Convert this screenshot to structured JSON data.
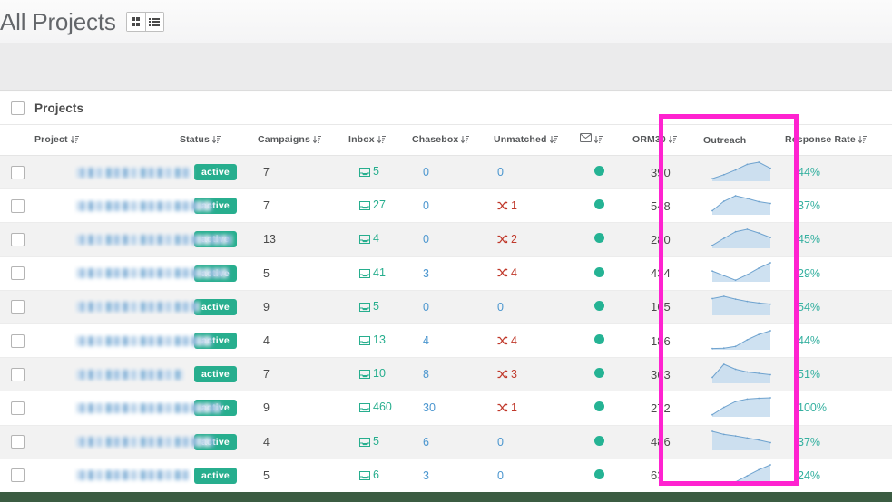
{
  "header": {
    "title": "All Projects",
    "view_toggle": [
      {
        "name": "grid-view",
        "label": "grid"
      },
      {
        "name": "list-view",
        "label": "list"
      }
    ]
  },
  "card": {
    "label": "Projects",
    "select_all_checkbox": ""
  },
  "columns": [
    {
      "key": "project",
      "label": "Project",
      "sortable": true
    },
    {
      "key": "status",
      "label": "Status",
      "sortable": true
    },
    {
      "key": "campaigns",
      "label": "Campaigns",
      "sortable": true
    },
    {
      "key": "inbox",
      "label": "Inbox",
      "sortable": true
    },
    {
      "key": "chasebox",
      "label": "Chasebox",
      "sortable": true
    },
    {
      "key": "unmatched",
      "label": "Unmatched",
      "sortable": true
    },
    {
      "key": "email",
      "label": "",
      "sortable": true,
      "icon": "envelope-icon"
    },
    {
      "key": "orm30",
      "label": "ORM30",
      "sortable": true
    },
    {
      "key": "outreach",
      "label": "Outreach",
      "sortable": false
    },
    {
      "key": "response",
      "label": "Response Rate",
      "sortable": true
    }
  ],
  "rows": [
    {
      "project_redacted_width": 128,
      "status": "active",
      "campaigns": "7",
      "inbox": "5",
      "chasebox": "0",
      "unmatched": "0",
      "unmatched_flagged": false,
      "email_status": "ok",
      "orm30": "390",
      "response": "44%",
      "sparkline": [
        12,
        30,
        52,
        78,
        88,
        60
      ]
    },
    {
      "project_redacted_width": 150,
      "status": "active",
      "campaigns": "7",
      "inbox": "27",
      "chasebox": "0",
      "unmatched": "1",
      "unmatched_flagged": true,
      "email_status": "ok",
      "orm30": "548",
      "response": "37%",
      "sparkline": [
        18,
        60,
        84,
        72,
        58,
        50
      ]
    },
    {
      "project_redacted_width": 172,
      "status": "active",
      "campaigns": "13",
      "inbox": "4",
      "chasebox": "0",
      "unmatched": "2",
      "unmatched_flagged": true,
      "email_status": "ok",
      "orm30": "280",
      "response": "45%",
      "sparkline": [
        14,
        48,
        80,
        92,
        74,
        52
      ]
    },
    {
      "project_redacted_width": 168,
      "status": "active",
      "campaigns": "5",
      "inbox": "41",
      "chasebox": "3",
      "unmatched": "4",
      "unmatched_flagged": true,
      "email_status": "ok",
      "orm30": "434",
      "response": "29%",
      "sparkline": [
        52,
        30,
        8,
        34,
        66,
        92
      ]
    },
    {
      "project_redacted_width": 136,
      "status": "active",
      "campaigns": "9",
      "inbox": "5",
      "chasebox": "0",
      "unmatched": "0",
      "unmatched_flagged": false,
      "email_status": "ok",
      "orm30": "165",
      "response": "54%",
      "sparkline": [
        60,
        68,
        58,
        50,
        44,
        40
      ]
    },
    {
      "project_redacted_width": 150,
      "status": "active",
      "campaigns": "4",
      "inbox": "13",
      "chasebox": "4",
      "unmatched": "4",
      "unmatched_flagged": true,
      "email_status": "ok",
      "orm30": "186",
      "response": "44%",
      "sparkline": [
        6,
        8,
        16,
        48,
        74,
        92
      ]
    },
    {
      "project_redacted_width": 118,
      "status": "active",
      "campaigns": "7",
      "inbox": "10",
      "chasebox": "8",
      "unmatched": "3",
      "unmatched_flagged": true,
      "email_status": "ok",
      "orm30": "363",
      "response": "51%",
      "sparkline": [
        26,
        84,
        62,
        50,
        44,
        38
      ]
    },
    {
      "project_redacted_width": 160,
      "status": "active",
      "campaigns": "9",
      "inbox": "460",
      "chasebox": "30",
      "unmatched": "1",
      "unmatched_flagged": true,
      "email_status": "ok",
      "orm30": "272",
      "response": "100%",
      "sparkline": [
        10,
        46,
        74,
        86,
        90,
        92
      ]
    },
    {
      "project_redacted_width": 152,
      "status": "active",
      "campaigns": "4",
      "inbox": "5",
      "chasebox": "6",
      "unmatched": "0",
      "unmatched_flagged": false,
      "email_status": "ok",
      "orm30": "486",
      "response": "37%",
      "sparkline": [
        74,
        62,
        56,
        48,
        40,
        30
      ]
    },
    {
      "project_redacted_width": 124,
      "status": "active",
      "campaigns": "5",
      "inbox": "6",
      "chasebox": "3",
      "unmatched": "0",
      "unmatched_flagged": false,
      "email_status": "ok",
      "orm30": "63",
      "response": "24%",
      "sparkline": [
        4,
        6,
        10,
        40,
        70,
        94
      ]
    }
  ],
  "annotation": {
    "highlight_color": "#ff22d0",
    "highlight_columns": [
      "ORM30",
      "Outreach"
    ]
  },
  "colors": {
    "badge_green": "#27ae8e",
    "status_dot_green": "#25b394",
    "link_blue": "#4b96cf",
    "flag_red": "#c0392b",
    "response_teal": "#35b0a0",
    "spark_fill": "#c6dcef",
    "spark_stroke": "#6fa3cf",
    "bottom_bar": "#3b5c42"
  }
}
